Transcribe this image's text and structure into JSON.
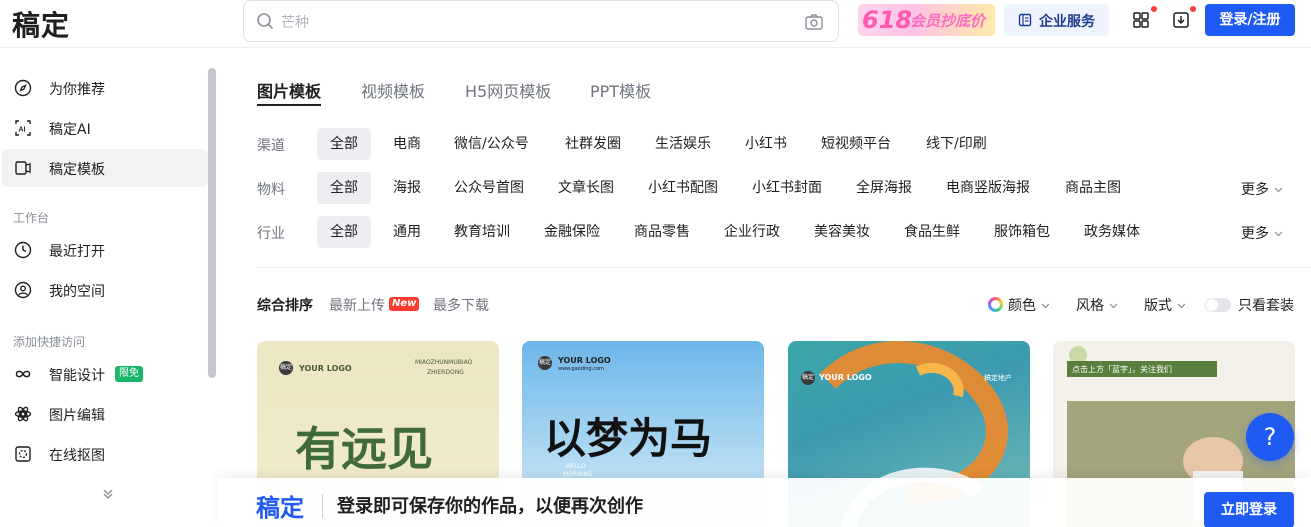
{
  "header": {
    "logo": "稿定",
    "search_placeholder": "芒种",
    "promo": {
      "num": "618",
      "text": "会员抄底价"
    },
    "enterprise": "企业服务",
    "login": "登录/注册",
    "icons": [
      "apps-icon",
      "download-icon"
    ]
  },
  "sidebar": {
    "items": [
      {
        "label": "为你推荐",
        "icon": "compass-icon"
      },
      {
        "label": "稿定AI",
        "icon": "ai-icon"
      },
      {
        "label": "稿定模板",
        "icon": "template-icon",
        "active": true
      }
    ],
    "workspace_label": "工作台",
    "workspace_items": [
      {
        "label": "最近打开",
        "icon": "clock-icon"
      },
      {
        "label": "我的空间",
        "icon": "user-icon"
      }
    ],
    "quick_label": "添加快捷访问",
    "quick_items": [
      {
        "label": "智能设计",
        "icon": "infinity-icon",
        "badge": "限免"
      },
      {
        "label": "图片编辑",
        "icon": "edit-icon"
      },
      {
        "label": "在线抠图",
        "icon": "cutout-icon"
      }
    ]
  },
  "main": {
    "tabs": [
      "图片模板",
      "视频模板",
      "H5网页模板",
      "PPT模板"
    ],
    "filters": {
      "channel": {
        "label": "渠道",
        "options": [
          "全部",
          "电商",
          "微信/公众号",
          "社群发圈",
          "生活娱乐",
          "小红书",
          "短视频平台",
          "线下/印刷"
        ]
      },
      "material": {
        "label": "物料",
        "options": [
          "全部",
          "海报",
          "公众号首图",
          "文章长图",
          "小红书配图",
          "小红书封面",
          "全屏海报",
          "电商竖版海报",
          "商品主图"
        ],
        "more": "更多"
      },
      "industry": {
        "label": "行业",
        "options": [
          "全部",
          "通用",
          "教育培训",
          "金融保险",
          "商品零售",
          "企业行政",
          "美容美妆",
          "食品生鲜",
          "服饰箱包",
          "政务媒体"
        ],
        "more": "更多"
      }
    },
    "sort": {
      "options": [
        "综合排序",
        "最新上传",
        "最多下载"
      ],
      "new_badge": "New"
    },
    "right_filters": {
      "color": "颜色",
      "style": "风格",
      "layout": "版式",
      "toggle_label": "只看套装"
    },
    "cards": [
      {
        "logo_text": "稿定",
        "brand": "YOUR LOGO",
        "sub": "MIAOZHUNMUBIAO",
        "sub2": "ZHIERDONG",
        "big": "有远见"
      },
      {
        "logo_text": "稿定",
        "brand": "YOUR LOGO",
        "sub": "www.gaoding.com",
        "big": "以梦为马",
        "hello": "HELLO",
        "morning": "MORNING"
      },
      {
        "logo_text": "稿定",
        "brand": "YOUR LOGO",
        "sub": "稿定地产"
      },
      {
        "banner": "点击上方「蓝字」，关注我们"
      }
    ]
  },
  "bottom_banner": {
    "logo": "稿定",
    "text": "登录即可保存你的作品，以便再次创作",
    "button": "立即登录"
  },
  "help": "?"
}
